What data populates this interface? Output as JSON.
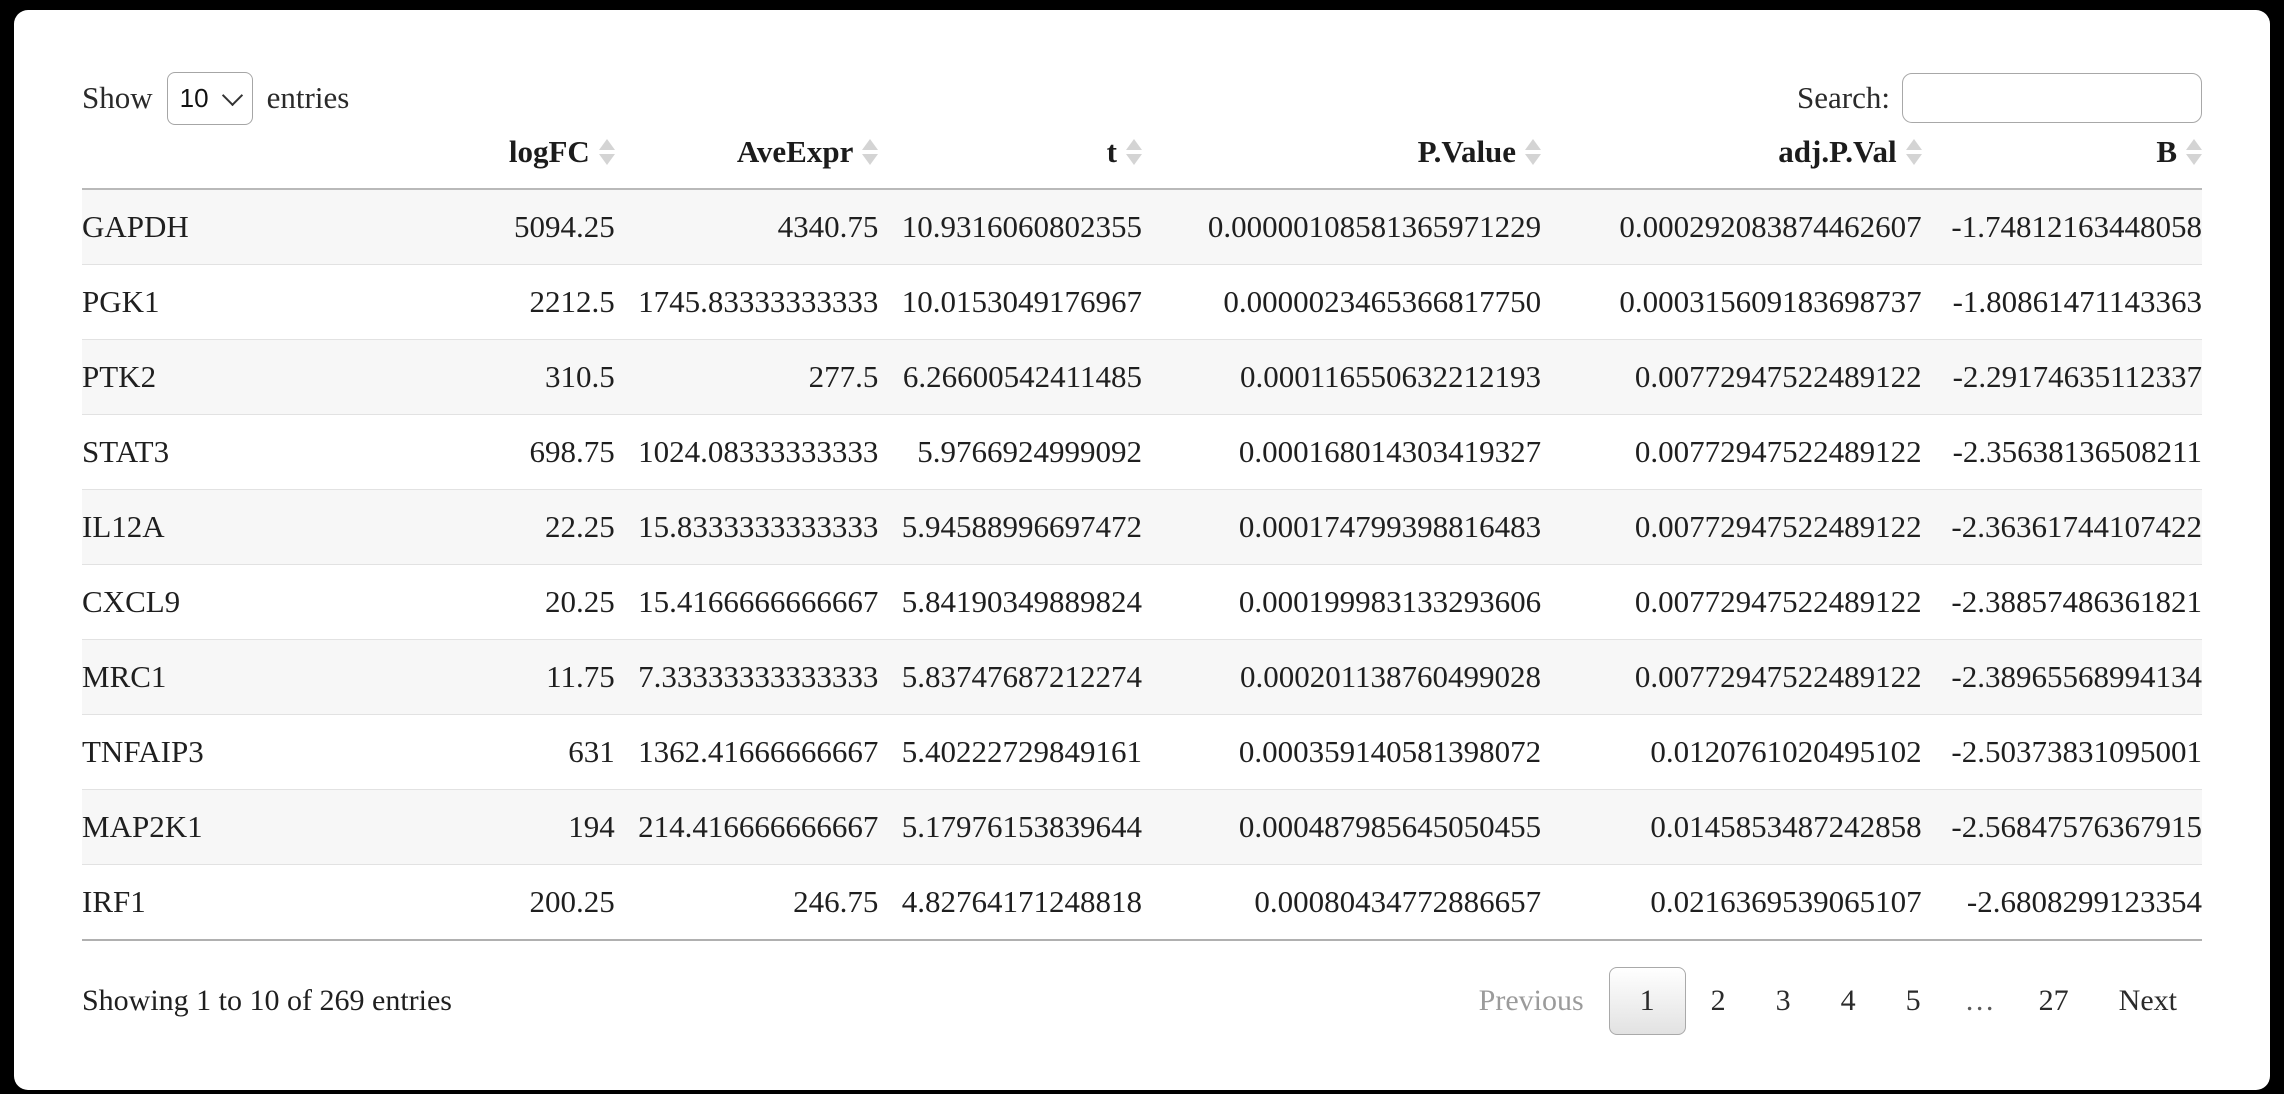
{
  "controls": {
    "length_label_pre": "Show",
    "length_label_post": "entries",
    "length_value": "10",
    "length_icon": "chevron-down-icon",
    "search_label": "Search:",
    "search_value": "",
    "search_placeholder": ""
  },
  "table": {
    "columns": [
      {
        "key": "gene",
        "label": ""
      },
      {
        "key": "logFC",
        "label": "logFC"
      },
      {
        "key": "AveExpr",
        "label": "AveExpr"
      },
      {
        "key": "t",
        "label": "t"
      },
      {
        "key": "PValue",
        "label": "P.Value"
      },
      {
        "key": "adjPVal",
        "label": "adj.P.Val"
      },
      {
        "key": "B",
        "label": "B"
      }
    ],
    "rows": [
      {
        "gene": "GAPDH",
        "logFC": "5094.25",
        "AveExpr": "4340.75",
        "t": "10.9316060802355",
        "PValue": "0.00000108581365971229",
        "adjPVal": "0.000292083874462607",
        "B": "-1.74812163448058"
      },
      {
        "gene": "PGK1",
        "logFC": "2212.5",
        "AveExpr": "1745.83333333333",
        "t": "10.0153049176967",
        "PValue": "0.0000023465366817750",
        "adjPVal": "0.000315609183698737",
        "B": "-1.80861471143363"
      },
      {
        "gene": "PTK2",
        "logFC": "310.5",
        "AveExpr": "277.5",
        "t": "6.26600542411485",
        "PValue": "0.000116550632212193",
        "adjPVal": "0.00772947522489122",
        "B": "-2.29174635112337"
      },
      {
        "gene": "STAT3",
        "logFC": "698.75",
        "AveExpr": "1024.08333333333",
        "t": "5.9766924999092",
        "PValue": "0.000168014303419327",
        "adjPVal": "0.00772947522489122",
        "B": "-2.35638136508211"
      },
      {
        "gene": "IL12A",
        "logFC": "22.25",
        "AveExpr": "15.8333333333333",
        "t": "5.94588996697472",
        "PValue": "0.000174799398816483",
        "adjPVal": "0.00772947522489122",
        "B": "-2.36361744107422"
      },
      {
        "gene": "CXCL9",
        "logFC": "20.25",
        "AveExpr": "15.4166666666667",
        "t": "5.84190349889824",
        "PValue": "0.000199983133293606",
        "adjPVal": "0.00772947522489122",
        "B": "-2.38857486361821"
      },
      {
        "gene": "MRC1",
        "logFC": "11.75",
        "AveExpr": "7.33333333333333",
        "t": "5.83747687212274",
        "PValue": "0.000201138760499028",
        "adjPVal": "0.00772947522489122",
        "B": "-2.38965568994134"
      },
      {
        "gene": "TNFAIP3",
        "logFC": "631",
        "AveExpr": "1362.41666666667",
        "t": "5.40222729849161",
        "PValue": "0.000359140581398072",
        "adjPVal": "0.0120761020495102",
        "B": "-2.50373831095001"
      },
      {
        "gene": "MAP2K1",
        "logFC": "194",
        "AveExpr": "214.416666666667",
        "t": "5.17976153839644",
        "PValue": "0.000487985645050455",
        "adjPVal": "0.0145853487242858",
        "B": "-2.56847576367915"
      },
      {
        "gene": "IRF1",
        "logFC": "200.25",
        "AveExpr": "246.75",
        "t": "4.82764171248818",
        "PValue": "0.00080434772886657",
        "adjPVal": "0.0216369539065107",
        "B": "-2.6808299123354"
      }
    ]
  },
  "footer": {
    "info": "Showing 1 to 10 of 269 entries",
    "previous_label": "Previous",
    "next_label": "Next",
    "pages": [
      "1",
      "2",
      "3",
      "4",
      "5",
      "…",
      "27"
    ],
    "active_page": "1"
  },
  "colors": {
    "page_background": "#000000",
    "panel_background": "#ffffff",
    "row_stripe": "#f7f7f7",
    "header_rule": "#b9b9b9",
    "row_rule": "#e2e2e2",
    "sort_arrow": "#d4d4d4",
    "text": "#1f1f1f",
    "muted_text": "#9b9b9b"
  }
}
